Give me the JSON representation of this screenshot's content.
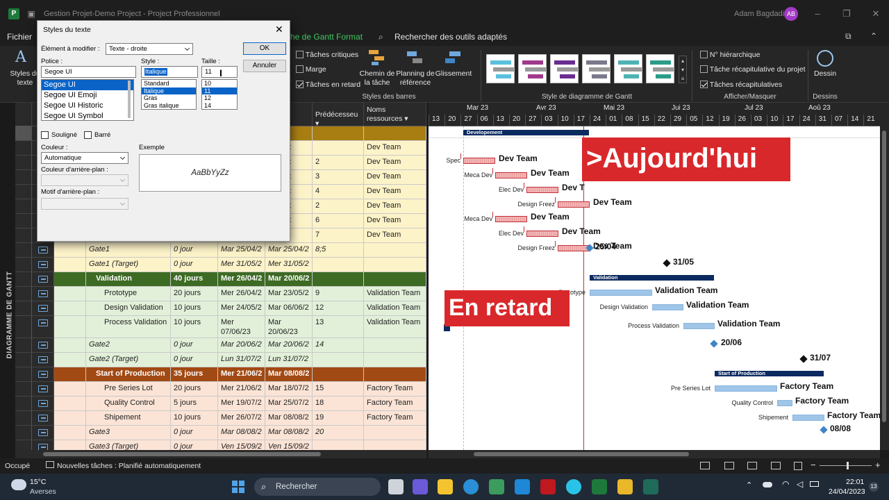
{
  "titlebar": {
    "title": "Gestion Projet-Demo Project - Project Professionnel",
    "user": "Adam Bagdadi",
    "user_initials": "AB"
  },
  "menu": {
    "file": "Fichier",
    "active_tab": "he de Gantt Format",
    "search": "Rechercher des outils adaptés"
  },
  "ribbon": {
    "styles_texte": "Styles du texte",
    "chk_critiques": "Tâches critiques",
    "chk_marge": "Marge",
    "chk_retard": "Tâches en retard",
    "chemin": "Chemin de la tâche",
    "planning": "Planning de référence",
    "glissement": "Glissement",
    "group_styles_barres": "Styles des barres",
    "group_style_gantt": "Style de diagramme de Gantt",
    "chk_hierarchique": "N° hiérarchique",
    "chk_recap_projet": "Tâche récapitulative du projet",
    "chk_recap": "Tâches récapitulatives",
    "group_afficher": "Afficher/Masquer",
    "dessin": "Dessin",
    "group_dessins": "Dessins",
    "style_colors": [
      "#5bc0de",
      "#a03a8c",
      "#6a2d91",
      "#7a7a8c",
      "#4fb3b3",
      "#2b9c8a"
    ]
  },
  "vertical_label": "DIAGRAMME DE GANTT",
  "table": {
    "headers": {
      "pred": "Prédécesseu",
      "res": "Noms ressources"
    },
    "rows": [
      {
        "n": "1",
        "name": "",
        "dur": "",
        "start": "",
        "end": "5/04/2",
        "pred": "",
        "res": "",
        "kind": "p1sum"
      },
      {
        "n": "2",
        "name": "",
        "dur": "",
        "start": "",
        "end": "5/03/2:",
        "pred": "",
        "res": "Dev Team",
        "kind": "p1"
      },
      {
        "n": "3",
        "name": "",
        "dur": "",
        "start": "",
        "end": "5/03/2:",
        "pred": "2",
        "res": "Dev Team",
        "kind": "p1"
      },
      {
        "n": "4",
        "name": "",
        "dur": "",
        "start": "",
        "end": "5/04/2:",
        "pred": "3",
        "res": "Dev Team",
        "kind": "p1"
      },
      {
        "n": "5",
        "name": "",
        "dur": "",
        "start": "",
        "end": "5/04/2:",
        "pred": "4",
        "res": "Dev Team",
        "kind": "p1"
      },
      {
        "n": "6",
        "name": "",
        "dur": "",
        "start": "",
        "end": "5/03/2:",
        "pred": "2",
        "res": "Dev Team",
        "kind": "p1"
      },
      {
        "n": "7",
        "name": "",
        "dur": "",
        "start": "",
        "end": "5/04/2:",
        "pred": "6",
        "res": "Dev Team",
        "kind": "p1"
      },
      {
        "n": "8",
        "name": "",
        "dur": "",
        "start": "",
        "end": "/04/2:",
        "pred": "7",
        "res": "Dev Team",
        "kind": "p1"
      },
      {
        "n": "9",
        "name": "Gate1",
        "dur": "0 jour",
        "start": "Mar 25/04/2",
        "end": "Mar 25/04/2",
        "pred": "8;5",
        "res": "",
        "kind": "p1it"
      },
      {
        "n": "10",
        "name": "Gate1 (Target)",
        "dur": "0 jour",
        "start": "Mer 31/05/2",
        "end": "Mer 31/05/2",
        "pred": "",
        "res": "",
        "kind": "p1it"
      },
      {
        "n": "11",
        "name": "Validation",
        "dur": "40 jours",
        "start": "Mer 26/04/2",
        "end": "Mar 20/06/2",
        "pred": "",
        "res": "",
        "kind": "p2sum"
      },
      {
        "n": "12",
        "name": "Prototype",
        "dur": "20 jours",
        "start": "Mer 26/04/2",
        "end": "Mar 23/05/2",
        "pred": "9",
        "res": "Validation Team",
        "kind": "p2"
      },
      {
        "n": "13",
        "name": "Design Validation",
        "dur": "10 jours",
        "start": "Mer 24/05/2",
        "end": "Mar 06/06/2",
        "pred": "12",
        "res": "Validation Team",
        "kind": "p2"
      },
      {
        "n": "14",
        "name": "Process Validation",
        "dur": "10 jours",
        "start": "Mer 07/06/23",
        "end": "Mar 20/06/23",
        "pred": "13",
        "res": "Validation Team",
        "kind": "p2tall"
      },
      {
        "n": "15",
        "name": "Gate2",
        "dur": "0 jour",
        "start": "Mar 20/06/2",
        "end": "Mar 20/06/2",
        "pred": "14",
        "res": "",
        "kind": "p2it"
      },
      {
        "n": "16",
        "name": "Gate2 (Target)",
        "dur": "0 jour",
        "start": "Lun 31/07/2",
        "end": "Lun 31/07/2",
        "pred": "",
        "res": "",
        "kind": "p2it"
      },
      {
        "n": "17",
        "name": "Start of Production",
        "dur": "35 jours",
        "start": "Mer 21/06/2",
        "end": "Mar 08/08/2",
        "pred": "",
        "res": "",
        "kind": "p3sum"
      },
      {
        "n": "18",
        "name": "Pre Series Lot",
        "dur": "20 jours",
        "start": "Mer 21/06/2",
        "end": "Mar 18/07/2",
        "pred": "15",
        "res": "Factory Team",
        "kind": "p3"
      },
      {
        "n": "19",
        "name": "Quality Control",
        "dur": "5 jours",
        "start": "Mer 19/07/2",
        "end": "Mar 25/07/2",
        "pred": "18",
        "res": "Factory Team",
        "kind": "p3"
      },
      {
        "n": "20",
        "name": "Shipement",
        "dur": "10 jours",
        "start": "Mer 26/07/2",
        "end": "Mar 08/08/2",
        "pred": "19",
        "res": "Factory Team",
        "kind": "p3"
      },
      {
        "n": "21",
        "name": "Gate3",
        "dur": "0 jour",
        "start": "Mar 08/08/2",
        "end": "Mar 08/08/2",
        "pred": "20",
        "res": "",
        "kind": "p3it"
      },
      {
        "n": "22",
        "name": "Gate3 (Target)",
        "dur": "0 jour",
        "start": "Ven 15/09/2",
        "end": "Ven 15/09/2",
        "pred": "",
        "res": "",
        "kind": "p3it"
      }
    ]
  },
  "gantt": {
    "months": [
      "Mar 23",
      "Avr 23",
      "Mai 23",
      "Jui 23",
      "Jul 23",
      "Aoû 23"
    ],
    "days": [
      "13",
      "20",
      "27",
      "06",
      "13",
      "20",
      "27",
      "03",
      "10",
      "17",
      "24",
      "01",
      "08",
      "15",
      "22",
      "29",
      "05",
      "12",
      "19",
      "26",
      "03",
      "10",
      "17",
      "24",
      "31",
      "07",
      "14",
      "21"
    ],
    "labels": {
      "developement": "Developement",
      "spec": "Spec",
      "meca": "Meca Dev",
      "elec": "Elec Dev",
      "design_freez": "Design Freez",
      "validation": "Validation",
      "prototype": "Prototype",
      "design_validation": "Design Validation",
      "process_validation": "Process Validation",
      "start_prod": "Start of Production",
      "pre_series": "Pre Series Lot",
      "quality": "Quality Control",
      "shipement": "Shipement",
      "dev_team": "Dev Team",
      "dev_team_cut": "Dev T",
      "validation_team": "Validation Team",
      "factory_team": "Factory Team",
      "factory_team_cut": "Factory Team",
      "d1": "25/04",
      "d2": "31/05",
      "d3": "20/06",
      "d4": "31/07",
      "d5": "08/08"
    }
  },
  "overlays": {
    "aujourdhui": ">Aujourd'hui",
    "retard": "En retard"
  },
  "dialog": {
    "title": "Styles du texte",
    "element_label": "Élément à modifier :",
    "element_value": "Texte - droite",
    "police_label": "Police :",
    "police_value": "Segoe UI",
    "fonts": [
      "Segoe UI",
      "Segoe UI Emoji",
      "Segoe UI Historic",
      "Segoe UI Symbol"
    ],
    "style_label": "Style :",
    "style_value": "Italique",
    "styles": [
      "Standard",
      "Italique",
      "Gras",
      "Gras italique"
    ],
    "taille_label": "Taille :",
    "taille_value": "11",
    "sizes": [
      "10",
      "11",
      "12",
      "14"
    ],
    "ok": "OK",
    "annuler": "Annuler",
    "souligne": "Souligné",
    "barre": "Barré",
    "couleur_label": "Couleur :",
    "couleur_value": "Automatique",
    "fond_label": "Couleur d'arrière-plan :",
    "motif_label": "Motif d'arrière-plan :",
    "exemple_label": "Exemple",
    "exemple_text": "AaBbYyZz"
  },
  "status": {
    "left": "Occupé",
    "new_tasks": "Nouvelles tâches : Planifié automatiquement"
  },
  "taskbar": {
    "temp": "15°C",
    "weather": "Averses",
    "search": "Rechercher",
    "time": "22:01",
    "date": "24/04/2023",
    "badge": "13"
  },
  "colors": {
    "p1": "#fdf3c9",
    "p1sum": "#a87d12",
    "p2": "#e2f0d9",
    "p2sum": "#3d6b24",
    "p3": "#fbe4d6",
    "p3sum": "#a24a14",
    "today": "#c0303a",
    "accent": "#3fc55f"
  }
}
